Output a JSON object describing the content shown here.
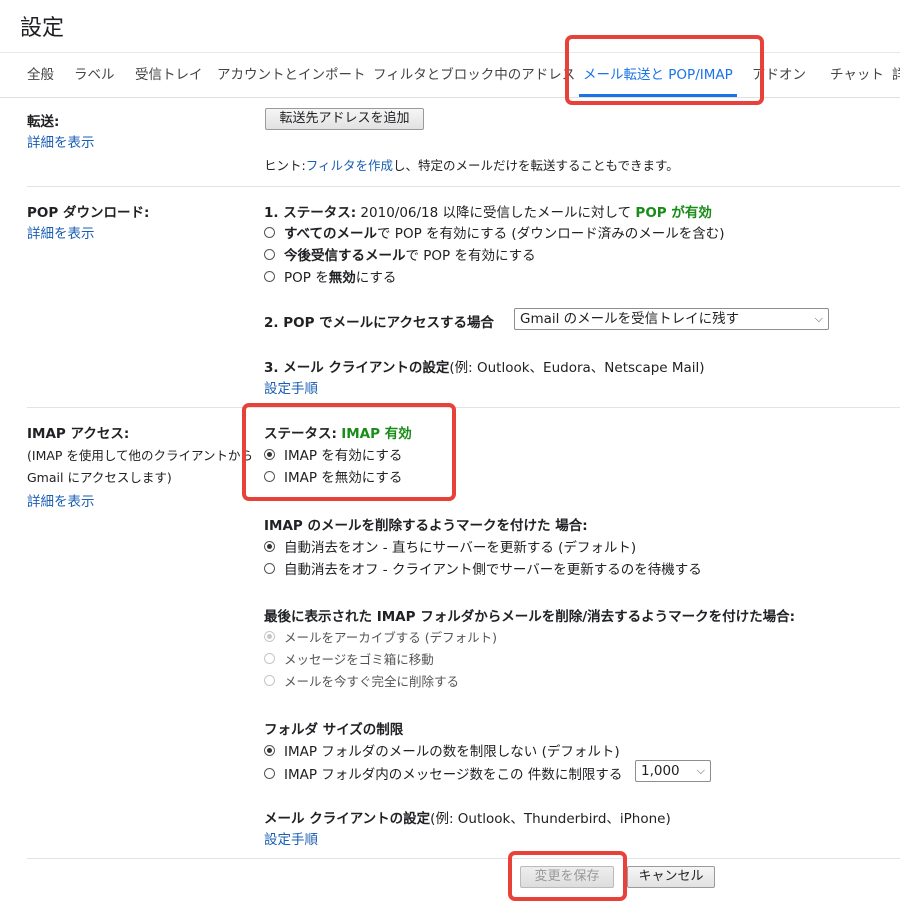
{
  "page_title": "設定",
  "tabs": [
    {
      "label": "全般"
    },
    {
      "label": "ラベル"
    },
    {
      "label": "受信トレイ"
    },
    {
      "label": "アカウントとインポート"
    },
    {
      "label": "フィルタとブロック中のアドレス"
    },
    {
      "label": "メール転送と POP/IMAP"
    },
    {
      "label": "アドオン"
    },
    {
      "label": "チャット"
    },
    {
      "label": "詳"
    }
  ],
  "forwarding": {
    "label": "転送:",
    "details_link": "詳細を表示",
    "add_button": "転送先アドレスを追加",
    "hint_prefix": "ヒント:",
    "hint_link": "フィルタを作成",
    "hint_suffix": "し、特定のメールだけを転送することもできます。"
  },
  "pop": {
    "label": "POP ダウンロード:",
    "details_link": "詳細を表示",
    "status_prefix": "1. ステータス:",
    "status_text": "2010/06/18 以降に受信したメールに対して",
    "status_value": "POP が有効",
    "options": [
      {
        "bold": "すべてのメール",
        "text": "で POP を有効にする (ダウンロード済みのメールを含む)"
      },
      {
        "bold": "今後受信するメール",
        "text": "で POP を有効にする"
      },
      {
        "bold": "",
        "text": "POP を",
        "bold2": "無効",
        "text2": "にする"
      }
    ],
    "access_label": "2. POP でメールにアクセスする場合",
    "access_select": "Gmail のメールを受信トレイに残す",
    "client_label": "3. メール クライアントの設定",
    "client_examples": "(例: Outlook、Eudora、Netscape Mail)",
    "client_link": "設定手順"
  },
  "imap": {
    "label": "IMAP アクセス:",
    "desc_line1": "(IMAP を使用して他のクライアントから",
    "desc_line2": "Gmail にアクセスします)",
    "details_link": "詳細を表示",
    "status_prefix": "ステータス:",
    "status_value": "IMAP 有効",
    "enable_label": "IMAP を有効にする",
    "disable_label": "IMAP を無効にする",
    "delete_heading": "IMAP のメールを削除するようマークを付けた 場合:",
    "delete_options": [
      "自動消去をオン - 直ちにサーバーを更新する (デフォルト)",
      "自動消去をオフ - クライアント側でサーバーを更新するのを待機する"
    ],
    "expunge_heading": "最後に表示された IMAP フォルダからメールを削除/消去するようマークを付けた場合:",
    "expunge_options": [
      "メールをアーカイブする (デフォルト)",
      "メッセージをゴミ箱に移動",
      "メールを今すぐ完全に削除する"
    ],
    "folder_heading": "フォルダ サイズの制限",
    "folder_option_1": "IMAP フォルダのメールの数を制限しない (デフォルト)",
    "folder_option_2": "IMAP フォルダ内のメッセージ数をこの 件数に制限する",
    "folder_limit_select": "1,000",
    "client_label": "メール クライアントの設定",
    "client_examples": "(例: Outlook、Thunderbird、iPhone)",
    "client_link": "設定手順"
  },
  "footer": {
    "save_button": "変更を保存",
    "cancel_button": "キャンセル"
  },
  "highlight_color": "#e8413a",
  "accent_color": "#1a73e8",
  "status_green": "#198c19"
}
